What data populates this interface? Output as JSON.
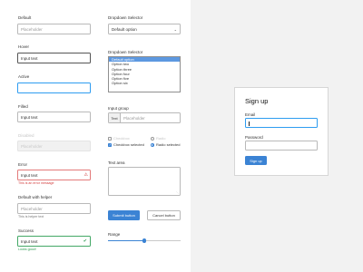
{
  "form": {
    "default": {
      "label": "Default",
      "placeholder": "Placeholder"
    },
    "hover": {
      "label": "Hover",
      "value": "Input text"
    },
    "active": {
      "label": "Active"
    },
    "filled": {
      "label": "Filled",
      "value": "Input text"
    },
    "disabled": {
      "label": "Disabled",
      "placeholder": "Placeholder"
    },
    "error": {
      "label": "Error",
      "value": "Input text",
      "message": "This is an error message",
      "icon": "warning-icon"
    },
    "helper": {
      "label": "Default with helper",
      "placeholder": "Placeholder",
      "message": "This is helper text"
    },
    "success": {
      "label": "Success",
      "value": "Input text",
      "message": "Looks good!",
      "icon": "check-icon"
    }
  },
  "dropdown": {
    "label": "Dropdown Selector",
    "selected": "Default option"
  },
  "listbox": {
    "label": "Dropdown Selector",
    "options": [
      "Default option",
      "Option two",
      "Option three",
      "Option four",
      "Option five",
      "Option six"
    ],
    "selected_index": 0
  },
  "input_group": {
    "label": "Input group",
    "prefix": "Text",
    "placeholder": "Placeholder"
  },
  "checks": {
    "checkbox": "Checkbox",
    "radio": "Radio",
    "checkbox_selected": "Checkbox selected",
    "radio_selected": "Radio selected"
  },
  "textarea": {
    "label": "Text area"
  },
  "buttons": {
    "submit": "Submit button",
    "cancel": "Cancel button"
  },
  "range": {
    "label": "Range",
    "value": 0.5
  },
  "signup": {
    "title": "Sign up",
    "email_label": "Email",
    "password_label": "Password",
    "button": "Sign up"
  },
  "colors": {
    "primary": "#3b83d4",
    "error": "#e37a7a",
    "success": "#43a866",
    "focus": "#2e9cf0",
    "panel": "#f2f2f2"
  }
}
